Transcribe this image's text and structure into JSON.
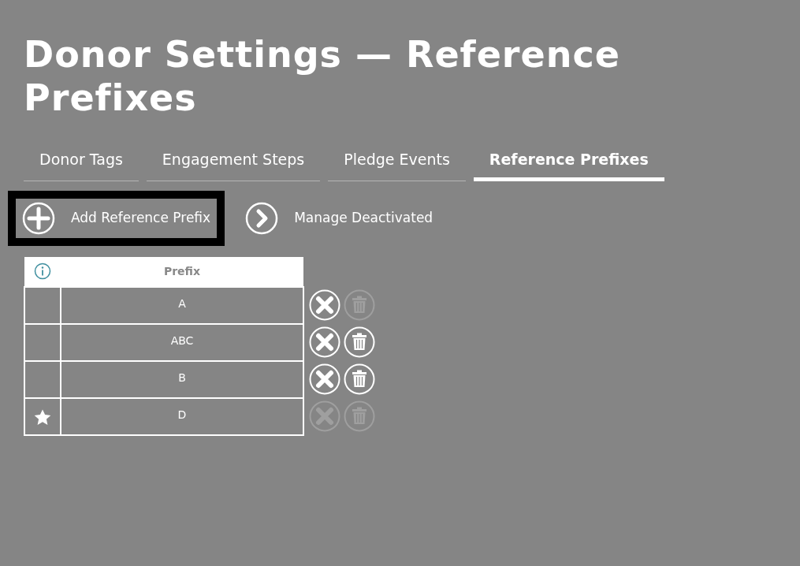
{
  "page_title": "Donor Settings — Reference Prefixes",
  "tabs": [
    {
      "label": "Donor Tags",
      "selected": false
    },
    {
      "label": "Engagement Steps",
      "selected": false
    },
    {
      "label": "Pledge Events",
      "selected": false
    },
    {
      "label": "Reference Prefixes",
      "selected": true
    }
  ],
  "actions": [
    {
      "kind": "add",
      "label": "Add Reference Prefix",
      "focused": true
    },
    {
      "kind": "next",
      "label": "Manage Deactivated",
      "focused": false
    }
  ],
  "table": {
    "columns": [
      "Prefix"
    ],
    "rows": [
      {
        "prefix": "A",
        "default": false,
        "deactivate_disabled": false,
        "delete_disabled": true
      },
      {
        "prefix": "ABC",
        "default": false,
        "deactivate_disabled": false,
        "delete_disabled": false
      },
      {
        "prefix": "B",
        "default": false,
        "deactivate_disabled": false,
        "delete_disabled": false
      },
      {
        "prefix": "D",
        "default": true,
        "deactivate_disabled": true,
        "delete_disabled": true
      }
    ]
  }
}
